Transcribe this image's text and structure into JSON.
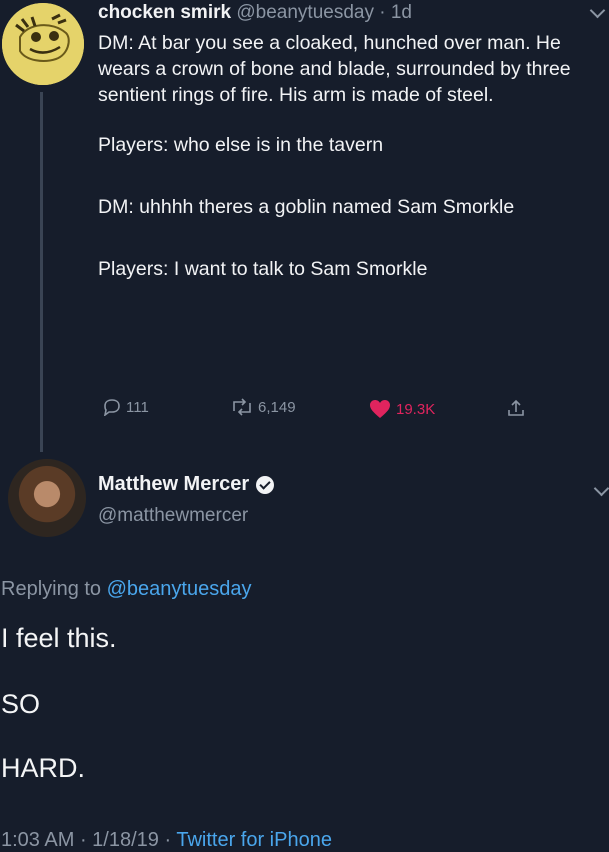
{
  "tweet1": {
    "display_name": "chocken smirk",
    "handle": "@beanytuesday",
    "time": " · 1d",
    "paragraphs": [
      "DM: At bar you see a cloaked, hunched over man. He wears a crown of bone and blade, surrounded by three sentient rings of fire. His arm is made of steel.",
      "Players: who else is in the tavern",
      "DM: uhhhh theres a goblin named Sam Smorkle",
      "Players: I want to talk to Sam Smorkle"
    ],
    "replies": "111",
    "retweets": "6,149",
    "likes": "19.3K",
    "avatar_icon": "pepe-avatar-icon"
  },
  "tweet2": {
    "display_name": "Matthew Mercer",
    "handle": "@matthewmercer",
    "replying_prefix": "Replying to ",
    "replying_to": "@beanytuesday",
    "lines": [
      "I feel this.",
      "SO",
      "HARD."
    ],
    "time": "1:03 AM",
    "date": "1/18/19",
    "source": "Twitter for iPhone",
    "sep": " · "
  },
  "colors": {
    "background": "#161d2b",
    "like": "#e0245e",
    "link": "#4aa6ec",
    "muted": "#8b95a3"
  }
}
